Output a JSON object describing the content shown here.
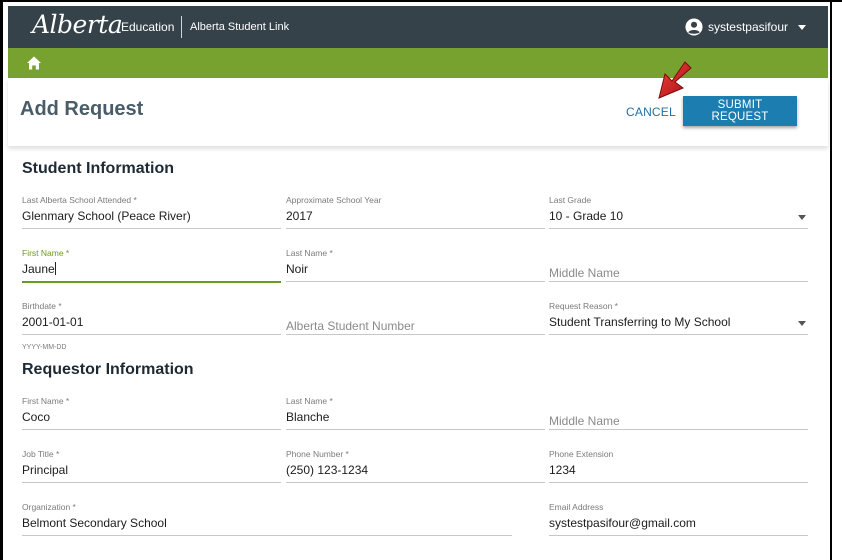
{
  "header": {
    "brand_script": "Alberta",
    "brand_dept": "Education",
    "app_name": "Alberta Student Link",
    "username": "systestpasifour"
  },
  "page": {
    "title": "Add Request",
    "cancel_label": "CANCEL",
    "submit_label": "SUBMIT REQUEST"
  },
  "student": {
    "section_title": "Student Information",
    "last_school": {
      "label": "Last Alberta School Attended *",
      "value": "Glenmary School (Peace River)"
    },
    "school_year": {
      "label": "Approximate School Year",
      "value": "2017"
    },
    "last_grade": {
      "label": "Last Grade",
      "value": "10 - Grade 10"
    },
    "first_name": {
      "label": "First Name *",
      "value": "Jaune"
    },
    "last_name": {
      "label": "Last Name *",
      "value": "Noir"
    },
    "middle_name": {
      "placeholder": "Middle Name"
    },
    "birthdate": {
      "label": "Birthdate *",
      "value": "2001-01-01",
      "hint": "YYYY-MM-DD"
    },
    "asn": {
      "placeholder": "Alberta Student Number"
    },
    "request_reason": {
      "label": "Request Reason *",
      "value": "Student Transferring to My School"
    }
  },
  "requestor": {
    "section_title": "Requestor Information",
    "first_name": {
      "label": "First Name *",
      "value": "Coco"
    },
    "last_name": {
      "label": "Last Name *",
      "value": "Blanche"
    },
    "middle_name": {
      "placeholder": "Middle Name"
    },
    "job_title": {
      "label": "Job Title *",
      "value": "Principal"
    },
    "phone": {
      "label": "Phone Number *",
      "value": "(250) 123-1234"
    },
    "phone_ext": {
      "label": "Phone Extension",
      "value": "1234"
    },
    "organization": {
      "label": "Organization *",
      "value": "Belmont Secondary School"
    },
    "email": {
      "label": "Email Address",
      "value": "systestpasifour@gmail.com"
    }
  },
  "colors": {
    "topbar": "#36424a",
    "navbar": "#77a22f",
    "accent_blue": "#1c7db1",
    "active_green": "#6b9a22",
    "annotation_arrow": "#d0161b"
  },
  "icons": [
    "user-circle-icon",
    "caret-down-icon",
    "home-icon",
    "red-arrow-annotation"
  ]
}
